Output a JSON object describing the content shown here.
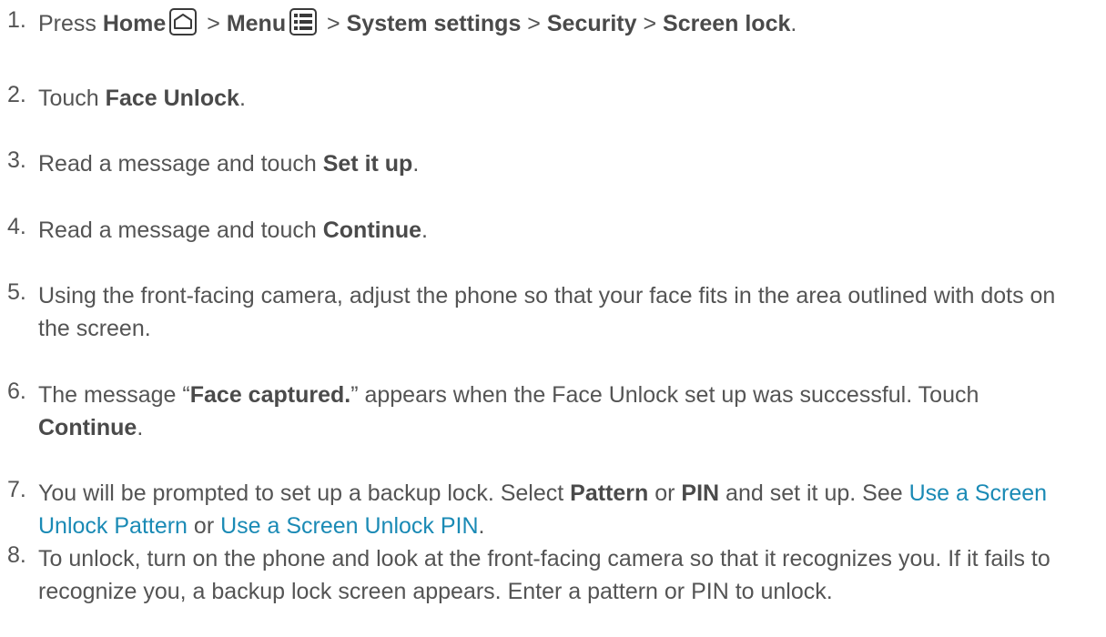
{
  "steps": [
    {
      "num": "1.",
      "press": "Press ",
      "home": "Home",
      "sep1": " > ",
      "menu": "Menu",
      "sep2": " > ",
      "system_settings": "System settings",
      "sep3": " > ",
      "security": "Security",
      "sep4": " > ",
      "screen_lock": "Screen lock",
      "end": "."
    },
    {
      "num": "2.",
      "pre": "Touch ",
      "bold": "Face Unlock",
      "post": "."
    },
    {
      "num": "3.",
      "pre": "Read a message and touch ",
      "bold": "Set it up",
      "post": "."
    },
    {
      "num": "4.",
      "pre": "Read a message and touch ",
      "bold": "Continue",
      "post": "."
    },
    {
      "num": "5.",
      "text": "Using the front-facing camera, adjust the phone so that your face fits in the area outlined with dots on the screen."
    },
    {
      "num": "6.",
      "pre": "The message “",
      "bold": "Face captured.",
      "mid": "” appears when the Face Unlock set up was successful. Touch ",
      "bold2": "Continue",
      "post": "."
    },
    {
      "num": "7.",
      "pre": "You will be prompted to set up a backup lock. Select ",
      "bold": "Pattern",
      "mid": " or ",
      "bold2": "PIN",
      "mid2": " and set it up. See ",
      "link1": "Use a Screen Unlock Pattern",
      "mid3": " or ",
      "link2": "Use a Screen Unlock PIN",
      "post": "."
    },
    {
      "num": "8.",
      "text": "To unlock, turn on the phone and look at the front-facing camera so that it recognizes you. If it fails to recognize you, a backup lock screen appears. Enter a pattern or PIN to unlock."
    }
  ],
  "icons": {
    "home": "home-icon",
    "menu": "menu-icon"
  },
  "colors": {
    "text": "#545454",
    "link": "#1a8ab5"
  }
}
